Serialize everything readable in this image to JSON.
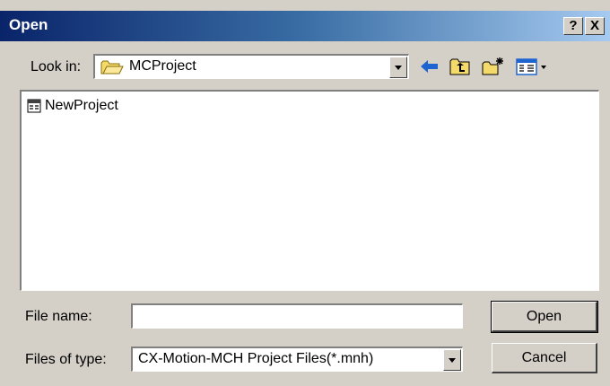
{
  "dialog": {
    "title": "Open",
    "help_button": "?",
    "close_button": "X"
  },
  "look_in": {
    "label": "Look in:",
    "value": "MCProject"
  },
  "toolbar": {
    "icons": [
      "back-arrow-icon",
      "up-one-level-icon",
      "create-new-folder-icon",
      "view-menu-icon"
    ]
  },
  "files": [
    {
      "name": "NewProject",
      "icon": "project-file-icon"
    }
  ],
  "file_name": {
    "label": "File name:",
    "value": ""
  },
  "files_of_type": {
    "label": "Files of type:",
    "value": "CX-Motion-MCH Project Files(*.mnh)"
  },
  "buttons": {
    "open": "Open",
    "cancel": "Cancel"
  },
  "colors": {
    "title_gradient_start": "#0a246a",
    "title_gradient_end": "#a6caf0",
    "dialog_bg": "#d4d0c8",
    "arrow_blue": "#1e64d0"
  }
}
